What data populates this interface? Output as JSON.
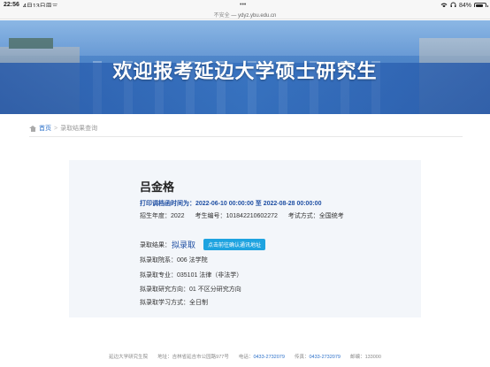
{
  "status_bar": {
    "time": "22:56",
    "date": "4月13日周三",
    "dots": "•••",
    "battery": "84%",
    "battery_level": 0.84
  },
  "browser": {
    "insecure": "不安全",
    "separator": " — ",
    "domain": "ydyz.ybu.edu.cn"
  },
  "banner": {
    "title": "欢迎报考延边大学硕士研究生"
  },
  "breadcrumb": {
    "home": "首页",
    "separator": ">",
    "current": "录取结果查询"
  },
  "result": {
    "name": "吕金格",
    "period_label": "打印调档函时间为：",
    "period_start": "2022-06-10 00:00:00",
    "period_to": "至",
    "period_end": "2022-08-28 00:00:00",
    "year_label": "招生年度：",
    "year": "2022",
    "exam_no_label": "考生编号：",
    "exam_no": "101842210602272",
    "exam_type_label": "考试方式：",
    "exam_type": "全国统考",
    "status_label": "录取结果：",
    "status": "拟录取",
    "confirm_button": "点击前往确认通讯地址",
    "dept_label": "拟录取院系：",
    "dept": "006 法学院",
    "major_label": "拟录取专业：",
    "major": "035101 法律（非法学）",
    "direction_label": "拟录取研究方向：",
    "direction": "01 不区分研究方向",
    "mode_label": "拟录取学习方式：",
    "mode": "全日制"
  },
  "footer": {
    "org": "延边大学研究生院",
    "address_label": "地址：",
    "address": "吉林省延吉市公园路977号",
    "phone_label": "电话：",
    "phone": "0433-2732079",
    "fax_label": "传真：",
    "fax": "0433-2732079",
    "zip_label": "邮编：",
    "zip": "133000"
  }
}
